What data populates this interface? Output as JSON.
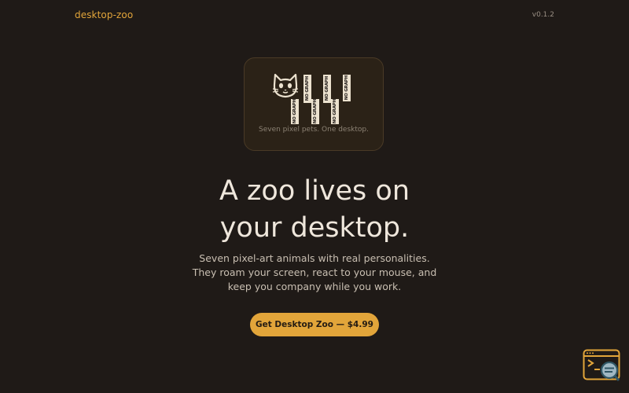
{
  "header": {
    "brand": "desktop-zoo",
    "version": "v0.1.2"
  },
  "hero_card": {
    "icon": "cat-icon",
    "tag_label": "NO GRAPH",
    "caption": "Seven pixel pets. One desktop."
  },
  "hero": {
    "headline_line1": "A zoo lives on",
    "headline_line2": "your desktop.",
    "subtitle": "Seven pixel-art animals with real personalities. They roam your screen, react to your mouse, and keep you company while you work.",
    "cta_label": "Get Desktop Zoo — $4.99"
  },
  "corner_widget": {
    "icon": "terminal-search-icon"
  },
  "colors": {
    "background": "#1f1a17",
    "accent": "#e2a53a",
    "card_bg": "#2b2217",
    "text": "#efe7dc",
    "muted": "#8c8274"
  }
}
